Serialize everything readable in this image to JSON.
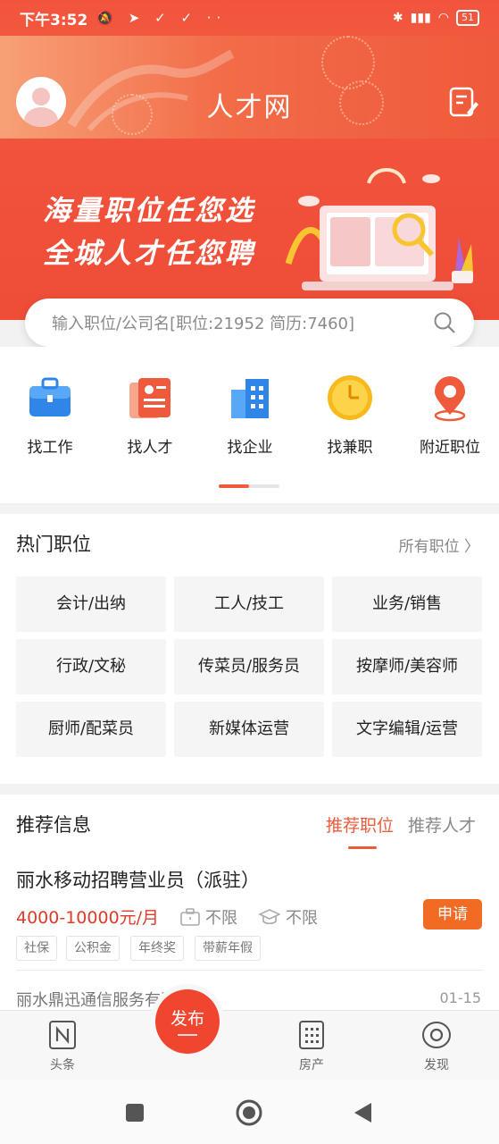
{
  "status_bar": {
    "time": "下午3:52",
    "battery": "51",
    "icons": [
      "mute-icon",
      "telegram-icon",
      "check-icon",
      "check-icon",
      "more-dots-icon",
      "bluetooth-icon",
      "signal-icon",
      "wifi-icon",
      "battery-icon"
    ]
  },
  "header": {
    "title": "人才网",
    "avatar_icon": "avatar-icon",
    "edit_icon": "edit-note-icon"
  },
  "banner": {
    "line1": "海量职位任您选",
    "line2": "全城人才任您聘"
  },
  "search": {
    "placeholder": "输入职位/公司名[职位:21952 简历:7460]"
  },
  "quick_nav": [
    {
      "label": "找工作",
      "icon": "briefcase-icon"
    },
    {
      "label": "找人才",
      "icon": "resume-icon"
    },
    {
      "label": "找企业",
      "icon": "building-icon"
    },
    {
      "label": "找兼职",
      "icon": "clock-icon"
    },
    {
      "label": "附近职位",
      "icon": "location-pin-icon"
    }
  ],
  "hot_jobs": {
    "title": "热门职位",
    "more": "所有职位",
    "items": [
      "会计/出纳",
      "工人/技工",
      "业务/销售",
      "行政/文秘",
      "传菜员/服务员",
      "按摩师/美容师",
      "厨师/配菜员",
      "新媒体运营",
      "文字编辑/运营"
    ]
  },
  "recommend": {
    "title": "推荐信息",
    "tab_active": "推荐职位",
    "tab_inactive": "推荐人才",
    "job": {
      "title": "丽水移动招聘营业员（派驻）",
      "salary": "4000-10000元/月",
      "experience": "不限",
      "education": "不限",
      "apply": "申请",
      "tags": [
        "社保",
        "公积金",
        "年终奖",
        "带薪年假"
      ]
    },
    "next_company": "丽水鼎迅通信服务有限公司",
    "next_date": "01-15"
  },
  "tabbar": {
    "items": [
      {
        "label": "头条",
        "icon": "news-icon"
      },
      {
        "label": "房产",
        "icon": "building-icon"
      },
      {
        "label": "发现",
        "icon": "eye-icon"
      }
    ],
    "publish": "发布"
  },
  "colors": {
    "accent": "#f05a3c",
    "apply_button": "#f26b25",
    "salary": "#e03b2a"
  }
}
